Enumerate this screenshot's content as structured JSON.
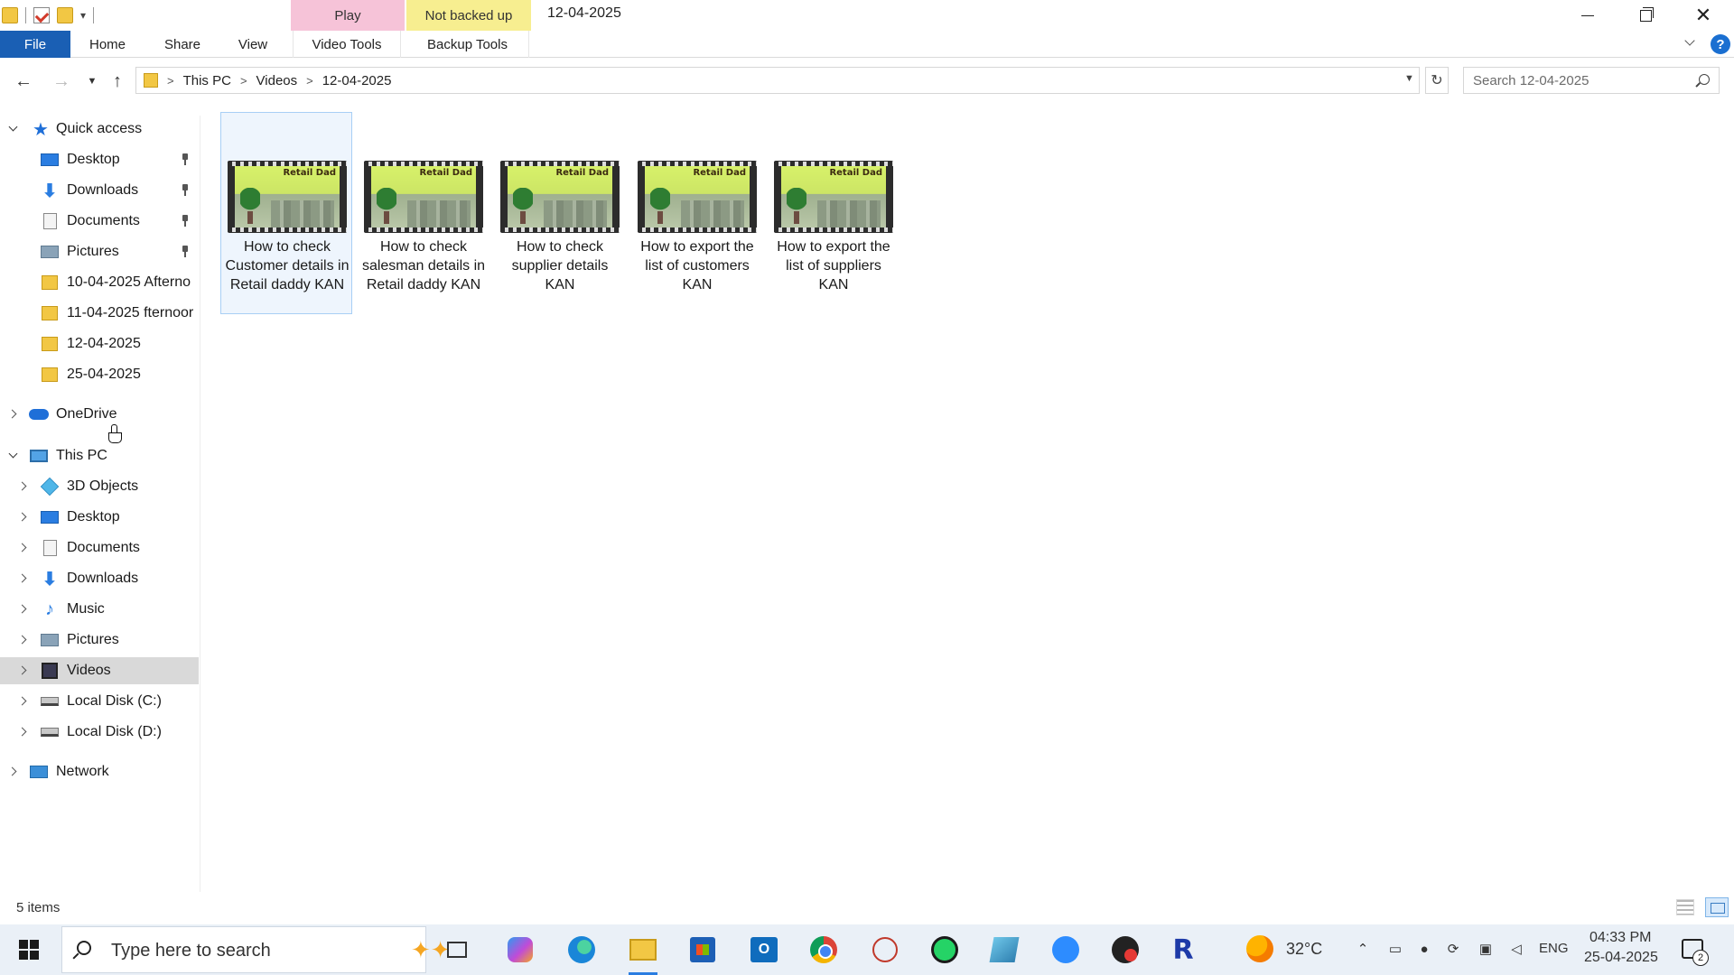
{
  "window": {
    "title": "12-04-2025",
    "context_tabs": {
      "play": "Play",
      "backup": "Not backed up"
    },
    "controls": {
      "minimize": "minimize",
      "maximize": "restore",
      "close": "✕"
    }
  },
  "ribbon": {
    "tabs": [
      "File",
      "Home",
      "Share",
      "View",
      "Video Tools",
      "Backup Tools"
    ],
    "help": "?"
  },
  "address": {
    "breadcrumb": [
      "This PC",
      "Videos",
      "12-04-2025"
    ],
    "search_placeholder": "Search 12-04-2025"
  },
  "nav": {
    "quick_access": {
      "label": "Quick access",
      "items": [
        {
          "label": "Desktop",
          "icon": "desktop-icon",
          "pinned": true
        },
        {
          "label": "Downloads",
          "icon": "downloads-icon",
          "pinned": true
        },
        {
          "label": "Documents",
          "icon": "documents-icon",
          "pinned": true
        },
        {
          "label": "Pictures",
          "icon": "pictures-icon",
          "pinned": true
        },
        {
          "label": "10-04-2025 Afterno",
          "icon": "folder-icon",
          "pinned": false
        },
        {
          "label": "11-04-2025 fternoor",
          "icon": "folder-icon",
          "pinned": false
        },
        {
          "label": "12-04-2025",
          "icon": "folder-icon",
          "pinned": false
        },
        {
          "label": "25-04-2025",
          "icon": "folder-icon",
          "pinned": false
        }
      ]
    },
    "onedrive": "OneDrive",
    "this_pc": {
      "label": "This PC",
      "items": [
        {
          "label": "3D Objects",
          "icon": "3d-objects-icon"
        },
        {
          "label": "Desktop",
          "icon": "desktop-icon"
        },
        {
          "label": "Documents",
          "icon": "documents-icon"
        },
        {
          "label": "Downloads",
          "icon": "downloads-icon"
        },
        {
          "label": "Music",
          "icon": "music-icon"
        },
        {
          "label": "Pictures",
          "icon": "pictures-icon"
        },
        {
          "label": "Videos",
          "icon": "videos-icon",
          "selected": true
        },
        {
          "label": "Local Disk (C:)",
          "icon": "disk-icon"
        },
        {
          "label": "Local Disk (D:)",
          "icon": "disk-icon"
        }
      ]
    },
    "network": "Network"
  },
  "files": [
    {
      "label": "How to check Customer details in Retail daddy KAN",
      "thumb_text": "Retail Dad",
      "selected": true
    },
    {
      "label": "How to check salesman details in Retail daddy KAN",
      "thumb_text": "Retail Dad",
      "selected": false
    },
    {
      "label": "How to check supplier details KAN",
      "thumb_text": "Retail Dad",
      "selected": false
    },
    {
      "label": "How to export the list of customers KAN",
      "thumb_text": "Retail Dad",
      "selected": false
    },
    {
      "label": "How to export the list of suppliers KAN",
      "thumb_text": "Retail Dad",
      "selected": false
    }
  ],
  "status": {
    "items": "5 items"
  },
  "taskbar": {
    "search_placeholder": "Type here to search",
    "pinned_apps": [
      "task-view",
      "copilot",
      "edge",
      "file-explorer",
      "microsoft-store",
      "outlook",
      "chrome",
      "snipping-tool",
      "whatsapp",
      "notes",
      "zoom",
      "recorder",
      "retail-daddy"
    ],
    "active_app": "file-explorer",
    "weather": "32°C",
    "language": "ENG",
    "time": "04:33 PM",
    "date": "25-04-2025",
    "notifications": "2"
  },
  "colors": {
    "file_tab": "#1a5fb4",
    "play_tab": "#f6c3d8",
    "backup_tab": "#f7ee90",
    "selection": "#d9d9d9"
  }
}
